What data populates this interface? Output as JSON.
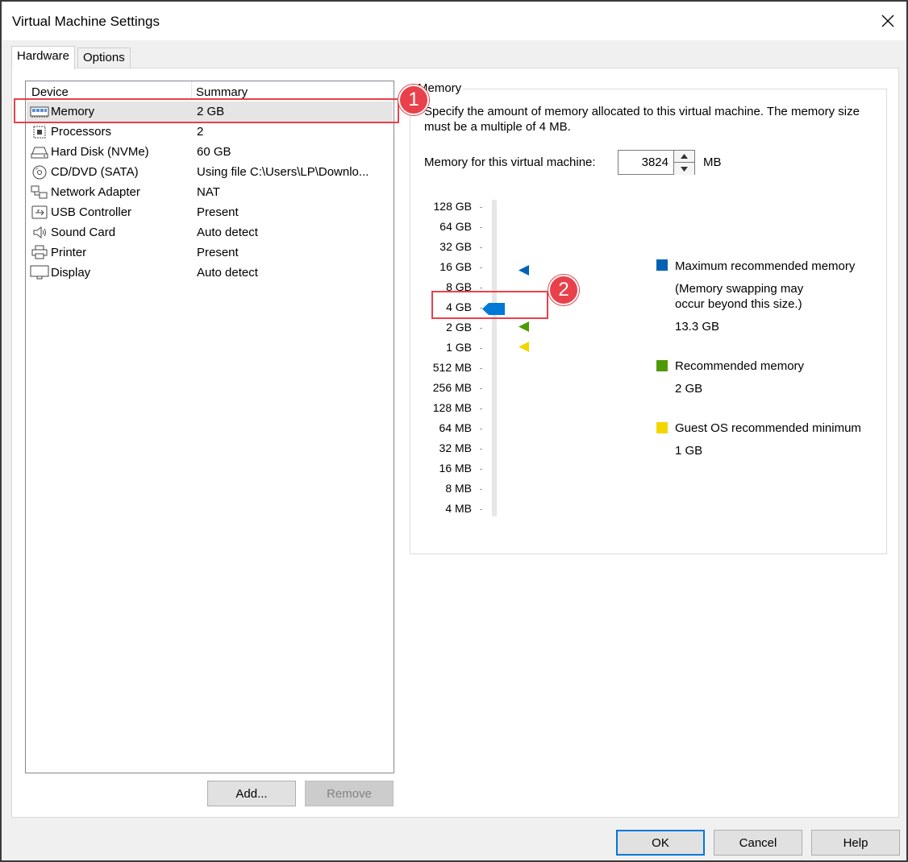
{
  "window": {
    "title": "Virtual Machine Settings"
  },
  "tabs": [
    {
      "label": "Hardware",
      "active": true
    },
    {
      "label": "Options",
      "active": false
    }
  ],
  "device_list": {
    "headers": {
      "device": "Device",
      "summary": "Summary"
    },
    "rows": [
      {
        "icon": "memory-icon",
        "name": "Memory",
        "summary": "2 GB",
        "selected": true
      },
      {
        "icon": "processor-icon",
        "name": "Processors",
        "summary": "2"
      },
      {
        "icon": "hard-disk-icon",
        "name": "Hard Disk (NVMe)",
        "summary": "60 GB"
      },
      {
        "icon": "cd-dvd-icon",
        "name": "CD/DVD (SATA)",
        "summary": "Using file C:\\Users\\LP\\Downlo..."
      },
      {
        "icon": "network-adapter-icon",
        "name": "Network Adapter",
        "summary": "NAT"
      },
      {
        "icon": "usb-icon",
        "name": "USB Controller",
        "summary": "Present"
      },
      {
        "icon": "speaker-icon",
        "name": "Sound Card",
        "summary": "Auto detect"
      },
      {
        "icon": "printer-icon",
        "name": "Printer",
        "summary": "Present"
      },
      {
        "icon": "monitor-icon",
        "name": "Display",
        "summary": "Auto detect"
      }
    ],
    "add_label": "Add...",
    "remove_label": "Remove"
  },
  "memory_panel": {
    "group_title": "Memory",
    "description": "Specify the amount of memory allocated to this virtual machine. The memory size must be a multiple of 4 MB.",
    "field_label": "Memory for this virtual machine:",
    "value": "3824",
    "unit": "MB",
    "scale_labels": [
      "128 GB",
      "64 GB",
      "32 GB",
      "16 GB",
      "8 GB",
      "4 GB",
      "2 GB",
      "1 GB",
      "512 MB",
      "256 MB",
      "128 MB",
      "64 MB",
      "32 MB",
      "16 MB",
      "8 MB",
      "4 MB"
    ],
    "legend": {
      "max": {
        "label": "Maximum recommended memory",
        "note": "(Memory swapping may occur beyond this size.)",
        "value": "13.3 GB",
        "color": "#0063b1"
      },
      "recommended": {
        "label": "Recommended memory",
        "value": "2 GB",
        "color": "#4e9a06"
      },
      "guest_min": {
        "label": "Guest OS recommended minimum",
        "value": "1 GB",
        "color": "#f2d600"
      }
    },
    "slider_color": "#0078d7"
  },
  "annotations": {
    "badge1": "1",
    "badge2": "2",
    "color": "#e8414b"
  },
  "footer": {
    "ok_label": "OK",
    "cancel_label": "Cancel",
    "help_label": "Help"
  }
}
